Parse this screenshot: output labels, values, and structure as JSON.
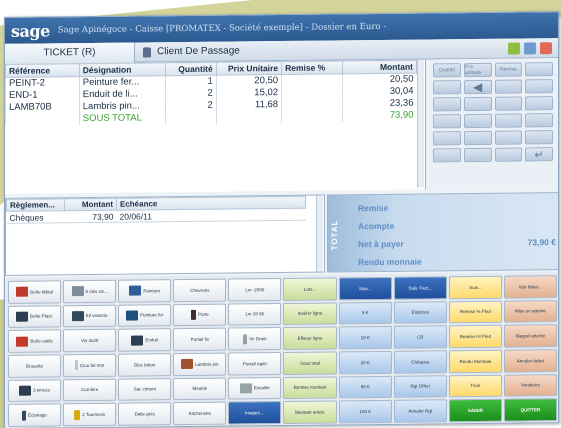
{
  "window": {
    "logo": "sage",
    "title": "Sage Apinégoce - Caisse [PROMATEX - Société exemple] - Dossier en Euro -"
  },
  "ticket": {
    "tab_label": "TICKET (R)",
    "customer": "Client De Passage",
    "customer_icon": "person-icon",
    "toolbar_icons": [
      "star-icon",
      "chart-icon",
      "print-icon"
    ]
  },
  "lines": {
    "columns": [
      "Référence",
      "Désignation",
      "Quantité",
      "Prix Unitaire",
      "Remise %",
      "Montant"
    ],
    "rows": [
      {
        "ref": "PEINT-2",
        "desc": "Peinture fer...",
        "qty": "1",
        "price": "20,50",
        "discount": "",
        "amount": "20,50"
      },
      {
        "ref": "END-1",
        "desc": "Enduit de li...",
        "qty": "2",
        "price": "15,02",
        "discount": "",
        "amount": "30,04"
      },
      {
        "ref": "LAMB70B",
        "desc": "Lambris pin...",
        "qty": "2",
        "price": "11,68",
        "discount": "",
        "amount": "23,36"
      }
    ],
    "subtotal_label": "SOUS TOTAL",
    "subtotal_amount": "73,90"
  },
  "keypad": {
    "top_labels": [
      "Quantit",
      "Prix unitaire",
      "Remise"
    ],
    "keys": [
      "",
      "",
      "",
      "",
      "",
      "",
      "",
      "",
      "",
      "",
      "",
      "",
      "",
      "",
      "",
      "",
      "",
      "",
      "",
      "",
      ""
    ]
  },
  "payments": {
    "columns": [
      "Règlemen...",
      "Montant",
      "Echéance"
    ],
    "rows": [
      {
        "mode": "Chèques",
        "amount": "73,90",
        "due": "20/06/11"
      }
    ]
  },
  "totals": {
    "side_label": "TOTAL",
    "remise_label": "Remise",
    "acompte_label": "Acompte",
    "net_label": "Net à payer",
    "net_value": "73,90 €",
    "rendu_label": "Rendu monnaie"
  },
  "panel": {
    "buttons": [
      [
        "Boîte Métal",
        "6 clés six...",
        "Peinture",
        "Chevrons",
        "Lvr -200€",
        "Lots...",
        "Suiv...",
        "Suiv. Fact...",
        "Suiv...",
        "Voir ticket..."
      ],
      [
        "Boîte Plast.",
        "Kit visserie",
        "Peinture fer",
        "Porte",
        "Lvr 20 €€",
        "Insérer ligne",
        "5 €",
        "Espèces",
        "Remise % Pied",
        "Mise en attente"
      ],
      [
        "Boîte outils",
        "Vis 4x30",
        "Enduit",
        "Portail fix",
        "Ve Drain",
        "Effacer ligne",
        "10 €",
        "CB",
        "Remise Ht Pied",
        "Rappel attente"
      ],
      [
        "Brouette",
        "Clou 50 mm",
        "Bloc béton",
        "Lambris pin",
        "Portail rapin",
        "Sous total",
        "20 €",
        "Chèques",
        "Rendu Monnaie",
        "Annuler ticket"
      ],
      [
        "3 pinces",
        "Cornière",
        "Sac ciment",
        "Meuble",
        "Escalier",
        "Remise montant",
        "50 €",
        "Rgt Offert",
        "Tiroir",
        "Vendeurs"
      ],
      [
        "Éclairage",
        "2 Tournevis",
        "Dalle grès",
        "Kitchenette",
        "Images ...",
        "Montant article",
        "100 €",
        "Annuler Rgt",
        "SAISIR",
        "QUITTER"
      ]
    ]
  },
  "colors": {
    "titlebar": "#2c5a90",
    "subtotal_text": "#37a02f",
    "totals_text": "#5f8fc5",
    "accent_green": "#1b8e1b"
  }
}
